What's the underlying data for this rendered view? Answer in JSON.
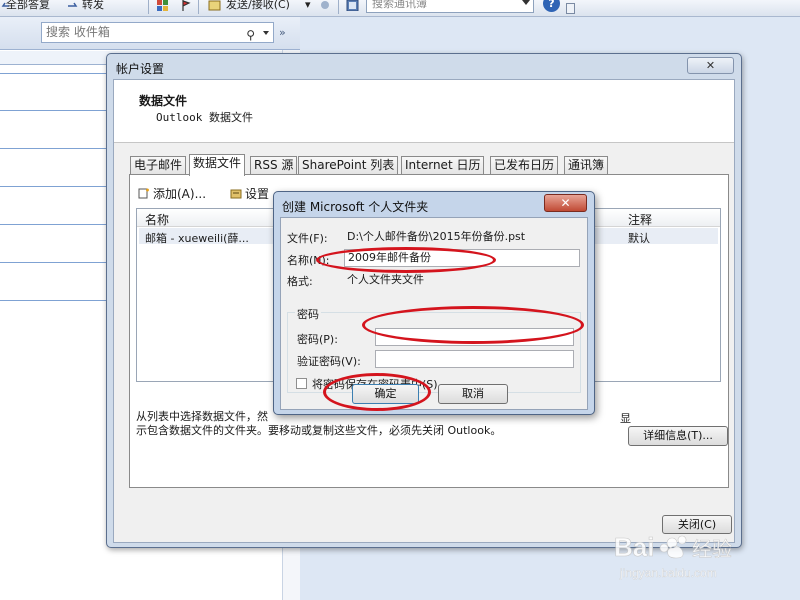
{
  "toolbar": {
    "reply_all": "全部答复",
    "forward": "转发",
    "send_receive": "发送/接收(C)",
    "addressbook_placeholder": "搜索通讯簿"
  },
  "left_pane": {
    "search_placeholder": "搜索 收件箱"
  },
  "account_dialog": {
    "title": "帐户设置",
    "close": "✕",
    "banner_title": "数据文件",
    "banner_subtitle": "Outlook 数据文件",
    "tabs": [
      "电子邮件",
      "数据文件",
      "RSS 源",
      "SharePoint 列表",
      "Internet 日历",
      "已发布日历",
      "通讯簿"
    ],
    "buttons": {
      "add": "添加(A)...",
      "settings": "设置"
    },
    "columns": {
      "name": "名称",
      "comment": "注释"
    },
    "row": {
      "name": "邮箱 - xueweili(薛...",
      "comment": "默认"
    },
    "info_line1": "从列表中选择数据文件，然",
    "info_line1_end": "显",
    "info_line2": "示包含数据文件的文件夹。要移动或复制这些文件，必须先关闭 Outlook。",
    "details_button": "详细信息(T)...",
    "close_button": "关闭(C)"
  },
  "pst_dialog": {
    "title": "创建 Microsoft 个人文件夹",
    "close": "✕",
    "file_label": "文件(F):",
    "file_value": "D:\\个人邮件备份\\2015年份备份.pst",
    "name_label": "名称(N):",
    "name_value": "2009年邮件备份",
    "format_label": "格式:",
    "format_value": "个人文件夹文件",
    "password_group": "密码",
    "password_label": "密码(P):",
    "verify_label": "验证密码(V):",
    "save_password_label": "将密码保存在密码表中(S)",
    "ok_label": "确定",
    "cancel_label": "取消"
  },
  "watermark": {
    "brand": "Bai",
    "brand2": "经验",
    "url": "jingyan.baidu.com"
  },
  "colors": {
    "annotation": "#d4141d",
    "accent": "#3c7fb1"
  }
}
